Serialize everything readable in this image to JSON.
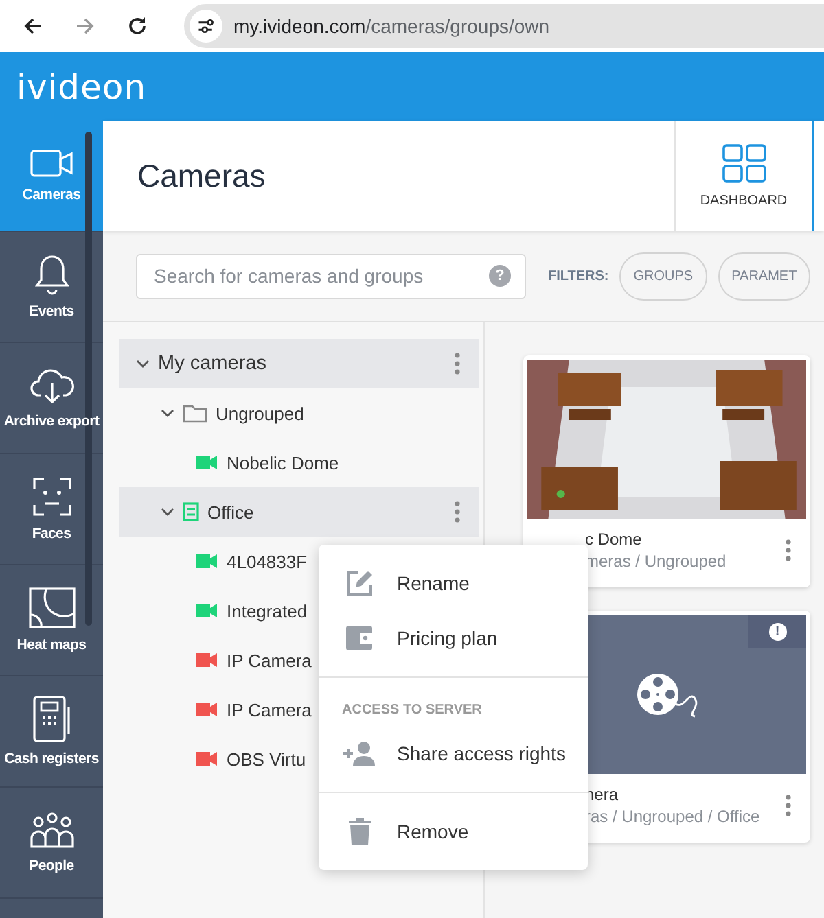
{
  "browser": {
    "back_enabled": true,
    "forward_enabled": false,
    "url_domain": "my.ivideon.com",
    "url_path": "/cameras/groups/own"
  },
  "brand": "ivideon",
  "sidebar": {
    "items": [
      {
        "kind": "camera",
        "label": "Cameras",
        "selected": true
      },
      {
        "kind": "bell",
        "label": "Events",
        "selected": false
      },
      {
        "kind": "cloud",
        "label": "Archive export",
        "selected": false
      },
      {
        "kind": "face",
        "label": "Faces",
        "selected": false
      },
      {
        "kind": "heatmap",
        "label": "Heat maps",
        "selected": false
      },
      {
        "kind": "register",
        "label": "Cash registers",
        "selected": false
      },
      {
        "kind": "people",
        "label": "People",
        "selected": false
      }
    ]
  },
  "page_title": "Cameras",
  "view_tabs": [
    {
      "label": "DASHBOARD",
      "selected": false
    }
  ],
  "search": {
    "placeholder": "Search for cameras and groups",
    "help": "?"
  },
  "filters": {
    "label": "FILTERS:",
    "chips": [
      "GROUPS",
      "PARAMET"
    ]
  },
  "tree": [
    {
      "kind": "group",
      "label": "My cameras",
      "expanded": true,
      "selected": true,
      "children": [
        {
          "kind": "folder",
          "label": "Ungrouped",
          "expanded": true,
          "selected": false,
          "children": [
            {
              "kind": "camera",
              "label": "Nobelic Dome",
              "color": "#1ed47a",
              "selected": false
            }
          ]
        },
        {
          "kind": "server",
          "label": "Office",
          "expanded": true,
          "selected": true,
          "children": [
            {
              "kind": "camera",
              "label": "4L04833F",
              "color": "#1ed47a",
              "selected": false
            },
            {
              "kind": "camera",
              "label": "Integrated",
              "color": "#1ed47a",
              "selected": false
            },
            {
              "kind": "camera",
              "label": "IP Camera",
              "color": "#f0544f",
              "selected": false
            },
            {
              "kind": "camera",
              "label": "IP Camera",
              "color": "#f0544f",
              "selected": false
            },
            {
              "kind": "camera",
              "label": "OBS Virtu",
              "color": "#f0544f",
              "selected": false
            }
          ]
        }
      ]
    }
  ],
  "cards": [
    {
      "kind": "picture",
      "title": "c Dome",
      "path": "meras / Ungrouped",
      "alert": false
    },
    {
      "kind": "placeholder",
      "title": "nera",
      "path": "ras / Ungrouped / Office",
      "alert": true,
      "alert_mark": "!"
    }
  ],
  "context_menu": [
    {
      "kind": "item",
      "label": "Rename"
    },
    {
      "kind": "item",
      "label": "Pricing plan"
    },
    {
      "kind": "divider"
    },
    {
      "kind": "section",
      "label": "ACCESS TO SERVER"
    },
    {
      "kind": "item",
      "label": "Share access rights"
    },
    {
      "kind": "divider"
    },
    {
      "kind": "item",
      "label": "Remove"
    }
  ]
}
